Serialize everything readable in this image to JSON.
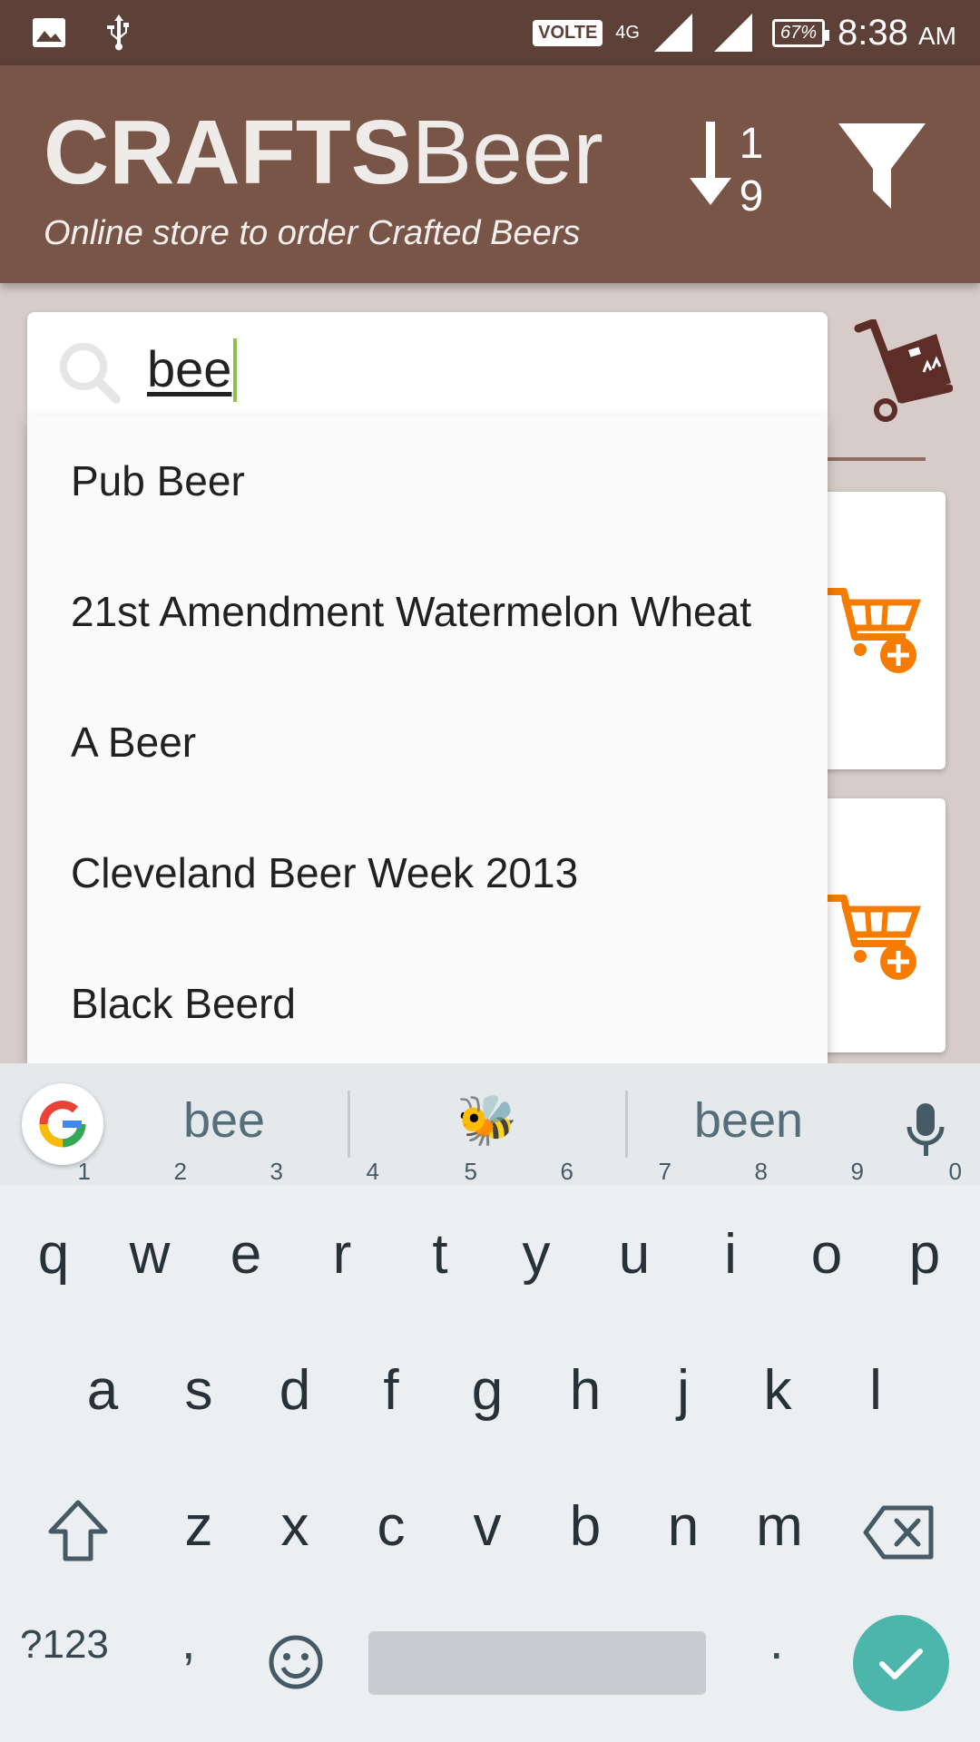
{
  "status_bar": {
    "volte": "VOLTE",
    "network": "4G",
    "sim1": "1",
    "sim2": "2",
    "battery": "67%",
    "time": "8:38",
    "ampm": "AM"
  },
  "app_bar": {
    "brand_bold": "CRAFTS",
    "brand_light": "Beer",
    "tagline": "Online store to order Crafted Beers",
    "sort_icon": "sort-numeric-descending-icon",
    "filter_icon": "filter-icon",
    "sort_digit_top": "1",
    "sort_digit_bottom": "9"
  },
  "search": {
    "value": "bee",
    "icon": "search-icon"
  },
  "suggestions": [
    "Pub Beer",
    "21st Amendment Watermelon Wheat",
    "A Beer",
    "Cleveland Beer Week 2013",
    "Black Beerd"
  ],
  "keyboard": {
    "strip_words": [
      "bee",
      "🐝",
      "been"
    ],
    "row1": [
      {
        "key": "q",
        "num": "1"
      },
      {
        "key": "w",
        "num": "2"
      },
      {
        "key": "e",
        "num": "3"
      },
      {
        "key": "r",
        "num": "4"
      },
      {
        "key": "t",
        "num": "5"
      },
      {
        "key": "y",
        "num": "6"
      },
      {
        "key": "u",
        "num": "7"
      },
      {
        "key": "i",
        "num": "8"
      },
      {
        "key": "o",
        "num": "9"
      },
      {
        "key": "p",
        "num": "0"
      }
    ],
    "row2": [
      "a",
      "s",
      "d",
      "f",
      "g",
      "h",
      "j",
      "k",
      "l"
    ],
    "row3": [
      "z",
      "x",
      "c",
      "v",
      "b",
      "n",
      "m"
    ],
    "symbols_label": "?123",
    "comma": ",",
    "period": "."
  },
  "colors": {
    "app_bar": "#795548",
    "status_bar": "#5d4037",
    "cart_orange": "#f57c00",
    "done_teal": "#4db6ac"
  }
}
